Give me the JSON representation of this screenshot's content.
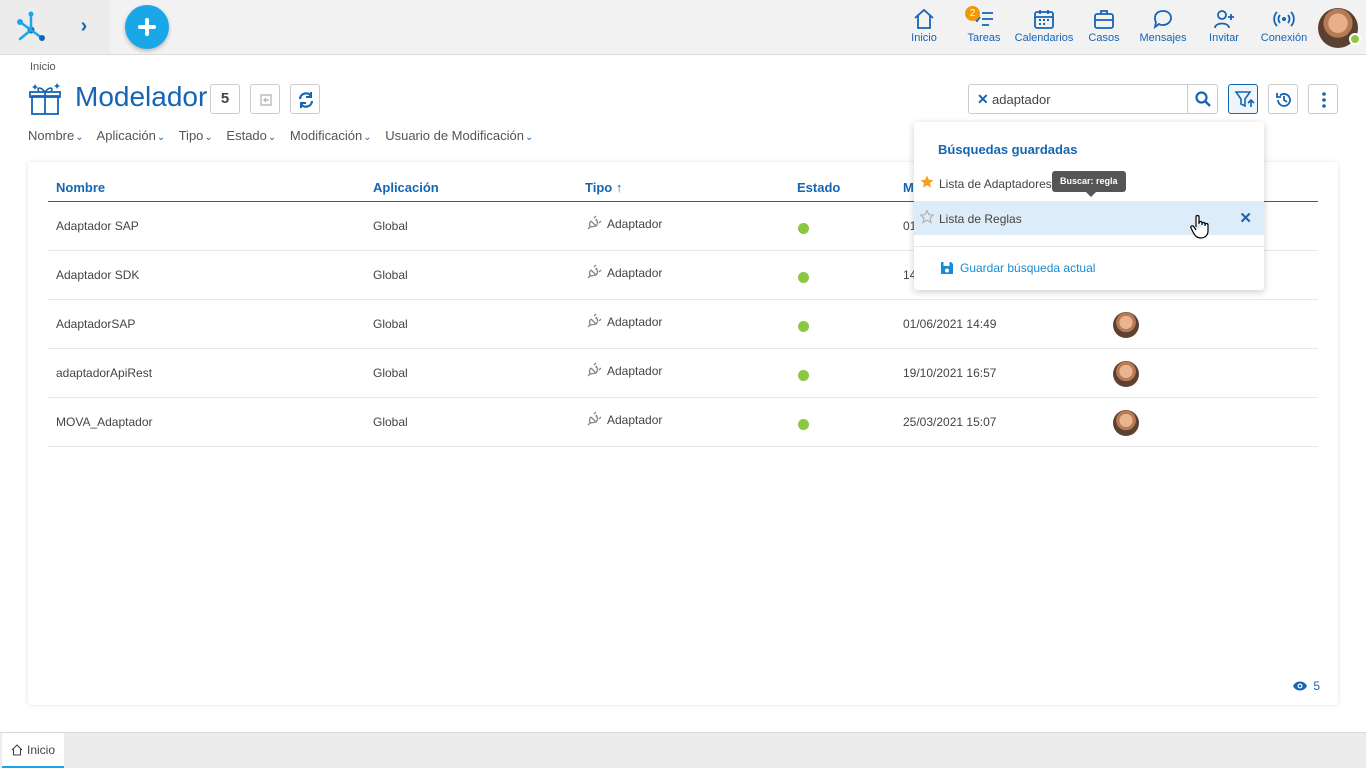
{
  "topbar": {
    "nav": [
      {
        "label": "Inicio",
        "icon": "home-icon"
      },
      {
        "label": "Tareas",
        "icon": "tasks-icon",
        "badge": "2"
      },
      {
        "label": "Calendarios",
        "icon": "calendar-icon"
      },
      {
        "label": "Casos",
        "icon": "briefcase-icon"
      },
      {
        "label": "Mensajes",
        "icon": "chat-icon"
      },
      {
        "label": "Invitar",
        "icon": "invite-user-icon"
      },
      {
        "label": "Conexión",
        "icon": "connection-icon"
      }
    ],
    "status_color": "#8dc63f"
  },
  "page": {
    "breadcrumb": "Inicio",
    "title": "Modelador",
    "count": "5"
  },
  "filters": [
    "Nombre",
    "Aplicación",
    "Tipo",
    "Estado",
    "Modificación",
    "Usuario de Modificación"
  ],
  "search": {
    "value": "adaptador"
  },
  "table": {
    "headers": {
      "name": "Nombre",
      "app": "Aplicación",
      "type": "Tipo",
      "state": "Estado",
      "modified": "M"
    },
    "rows": [
      {
        "name": "Adaptador SAP",
        "app": "Global",
        "type": "Adaptador",
        "modified": "01"
      },
      {
        "name": "Adaptador SDK",
        "app": "Global",
        "type": "Adaptador",
        "modified": "14"
      },
      {
        "name": "AdaptadorSAP",
        "app": "Global",
        "type": "Adaptador",
        "modified": "01/06/2021 14:49"
      },
      {
        "name": "adaptadorApiRest",
        "app": "Global",
        "type": "Adaptador",
        "modified": "19/10/2021 16:57"
      },
      {
        "name": "MOVA_Adaptador",
        "app": "Global",
        "type": "Adaptador",
        "modified": "25/03/2021 15:07"
      }
    ],
    "visible_count": "5"
  },
  "saved_searches": {
    "title": "Búsquedas guardadas",
    "items": [
      {
        "label": "Lista de Adaptadores",
        "favorite": true
      },
      {
        "label": "Lista de Reglas",
        "favorite": false
      }
    ],
    "save_label": "Guardar búsqueda actual",
    "tooltip": "Buscar: regla"
  },
  "bottom_tabs": [
    {
      "label": "Inicio"
    }
  ],
  "colors": {
    "accent": "#1565b4",
    "fab": "#1aa7e8",
    "status_ok": "#8dc63f",
    "badge": "#f29900"
  }
}
